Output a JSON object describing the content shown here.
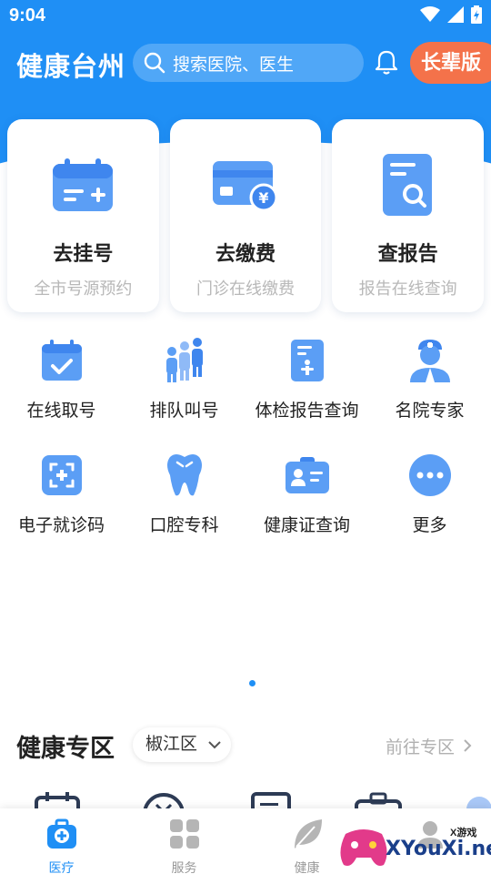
{
  "status_bar": {
    "time": "9:04"
  },
  "header": {
    "title": "健康台州",
    "search_placeholder": "搜索医院、医生",
    "elder_mode": "长辈版"
  },
  "cards": [
    {
      "title": "去挂号",
      "subtitle": "全市号源预约",
      "icon": "calendar-add-icon"
    },
    {
      "title": "去缴费",
      "subtitle": "门诊在线缴费",
      "icon": "card-payment-icon"
    },
    {
      "title": "查报告",
      "subtitle": "报告在线查询",
      "icon": "report-search-icon"
    }
  ],
  "services_row1": [
    {
      "label": "在线取号",
      "icon": "calendar-check-icon"
    },
    {
      "label": "排队叫号",
      "icon": "queue-people-icon"
    },
    {
      "label": "体检报告查询",
      "icon": "checkup-report-icon"
    },
    {
      "label": "名院专家",
      "icon": "doctor-icon"
    }
  ],
  "services_row2": [
    {
      "label": "电子就诊码",
      "icon": "qr-scan-icon"
    },
    {
      "label": "口腔专科",
      "icon": "tooth-icon"
    },
    {
      "label": "健康证查询",
      "icon": "health-card-icon"
    },
    {
      "label": "更多",
      "icon": "more-icon"
    }
  ],
  "zone": {
    "title": "健康专区",
    "district": "椒江区",
    "go_link": "前往专区"
  },
  "tabbar": [
    {
      "label": "医疗",
      "active": true,
      "icon": "medical-kit-icon"
    },
    {
      "label": "服务",
      "active": false,
      "icon": "grid-icon"
    },
    {
      "label": "健康",
      "active": false,
      "icon": "leaf-icon"
    },
    {
      "label": "",
      "active": false,
      "icon": "user-icon"
    }
  ],
  "watermark": {
    "text": "XYouXi.net",
    "small": "X游戏"
  },
  "colors": {
    "primary": "#1f8ff5",
    "accent": "#f4724a"
  }
}
